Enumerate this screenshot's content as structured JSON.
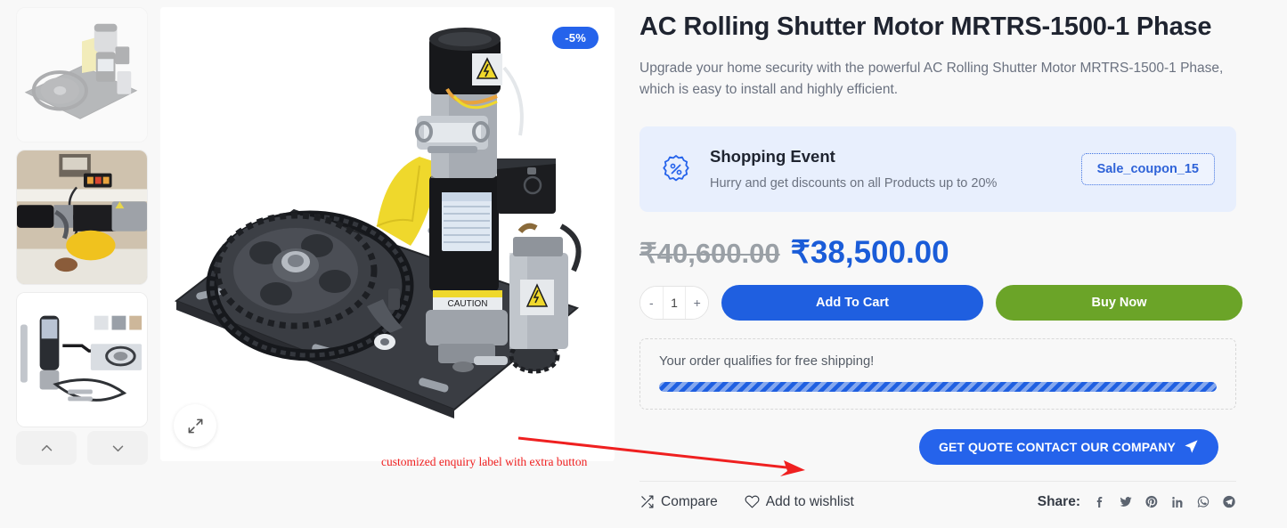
{
  "product": {
    "title": "AC Rolling Shutter Motor MRTRS-1500-1 Phase",
    "subtitle": "Upgrade your home security with the powerful AC Rolling Shutter Motor MRTRS-1500-1 Phase, which is easy to install and highly efficient.",
    "discount_badge": "-5%",
    "price_old": "₹40,600.00",
    "price_new": "₹38,500.00",
    "accent_blue": "#1f5fe0",
    "accent_green": "#6ba428"
  },
  "gallery": {
    "expand_icon": "expand-icon",
    "prev_icon": "chevron-up-icon",
    "next_icon": "chevron-down-icon",
    "thumbs": [
      {
        "alt": "Rolling shutter motor on mounting plate",
        "active": false
      },
      {
        "alt": "Motor installed above shutter with remote",
        "active": true
      },
      {
        "alt": "Motor kit with chain and accessories",
        "active": false
      }
    ]
  },
  "event": {
    "icon": "discount-seal-icon",
    "title": "Shopping Event",
    "subtitle": "Hurry and get discounts on all Products up to 20%",
    "coupon_code": "Sale_coupon_15"
  },
  "cart": {
    "qty_decrease": "-",
    "qty_value": "1",
    "qty_increase": "+",
    "add_to_cart": "Add To Cart",
    "buy_now": "Buy Now"
  },
  "shipping": {
    "message": "Your order qualifies for free shipping!",
    "progress_percent": 100
  },
  "quote": {
    "label": "GET QUOTE CONTACT OUR COMPANY",
    "icon": "send-icon"
  },
  "footer": {
    "compare": "Compare",
    "compare_icon": "shuffle-icon",
    "wishlist": "Add to wishlist",
    "wishlist_icon": "heart-icon",
    "share_label": "Share:",
    "social": [
      {
        "name": "facebook-icon"
      },
      {
        "name": "twitter-icon"
      },
      {
        "name": "pinterest-icon"
      },
      {
        "name": "linkedin-icon"
      },
      {
        "name": "whatsapp-icon"
      },
      {
        "name": "telegram-icon"
      }
    ]
  },
  "annotation": {
    "text": "customized enquiry label with extra button",
    "color": "#ef2020"
  }
}
